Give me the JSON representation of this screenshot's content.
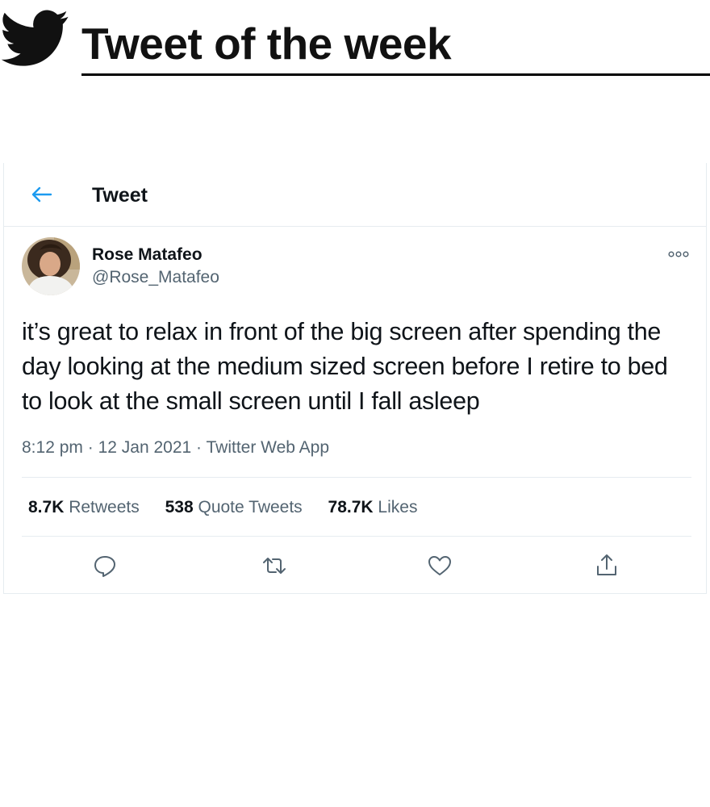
{
  "header": {
    "title": "Tweet of the week",
    "icon": "twitter-bird-icon"
  },
  "topbar": {
    "back_icon": "arrow-left-icon",
    "title": "Tweet"
  },
  "tweet": {
    "author": {
      "name": "Rose Matafeo",
      "handle": "@Rose_Matafeo"
    },
    "text": "it’s great to relax in front of the big screen after spending the day looking at the medium sized screen before I retire to bed to look at the small screen until I fall asleep",
    "time": "8:12 pm",
    "date": "12 Jan 2021",
    "source": "Twitter Web App",
    "separator": "·",
    "stats": {
      "retweets_count": "8.7K",
      "retweets_label": "Retweets",
      "quotes_count": "538",
      "quotes_label": "Quote Tweets",
      "likes_count": "78.7K",
      "likes_label": "Likes"
    }
  },
  "colors": {
    "accent": "#1d9bf0",
    "text": "#0f1419",
    "secondary": "#536471",
    "border": "#e6ecf0"
  }
}
